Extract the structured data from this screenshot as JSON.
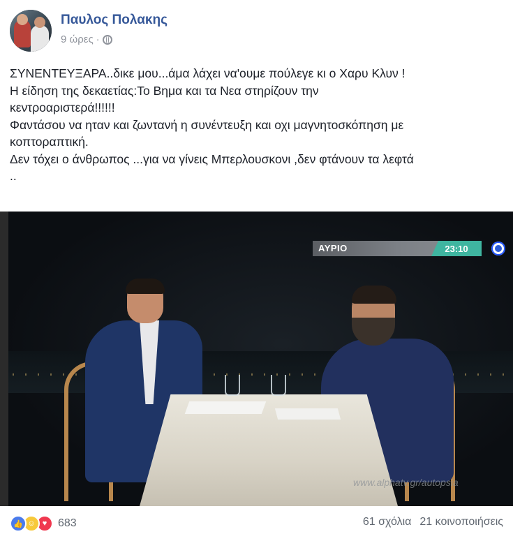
{
  "post": {
    "author": "Παυλος Πολακης",
    "time": "9 ώρες",
    "separator": "·",
    "privacy_icon": "globe-icon",
    "text_lines": [
      "ΣΥΝΕΝΤΕΥΞΑΡΑ..δικε μου...άμα λάχει να'ουμε πούλεγε κι ο Χαρυ Κλυν !",
      "Η είδηση της δεκαετίας:Το Βημα και τα Νεα στηρίζουν την",
      "κεντροαριστερά!!!!!!",
      "Φαντάσου να ηταν και ζωντανή η συνέντευξη και οχι μαγνητοσκόπηση με",
      "κοπτοραπτική.",
      "Δεν τόχει ο άνθρωπος ...για να γίνεις Μπερλουσκονι ,δεν φτάνουν τα λεφτά",
      ".."
    ]
  },
  "video": {
    "banner_label": "ΑΥΡΙΟ",
    "banner_time": "23:10",
    "watermark": "www.alphatv.gr/autopsia"
  },
  "footer": {
    "reaction_icons": [
      "like-icon",
      "haha-icon",
      "love-icon"
    ],
    "reaction_count": "683",
    "comments": "61 σχόλια",
    "shares": "21 κοινοποιήσεις"
  },
  "colors": {
    "author": "#365899",
    "meta": "#90949c",
    "text": "#1d2129",
    "like": "#4a7bec",
    "haha": "#f7c93b",
    "love": "#f0384f",
    "banner_time_bg": "#3fb5a0"
  }
}
